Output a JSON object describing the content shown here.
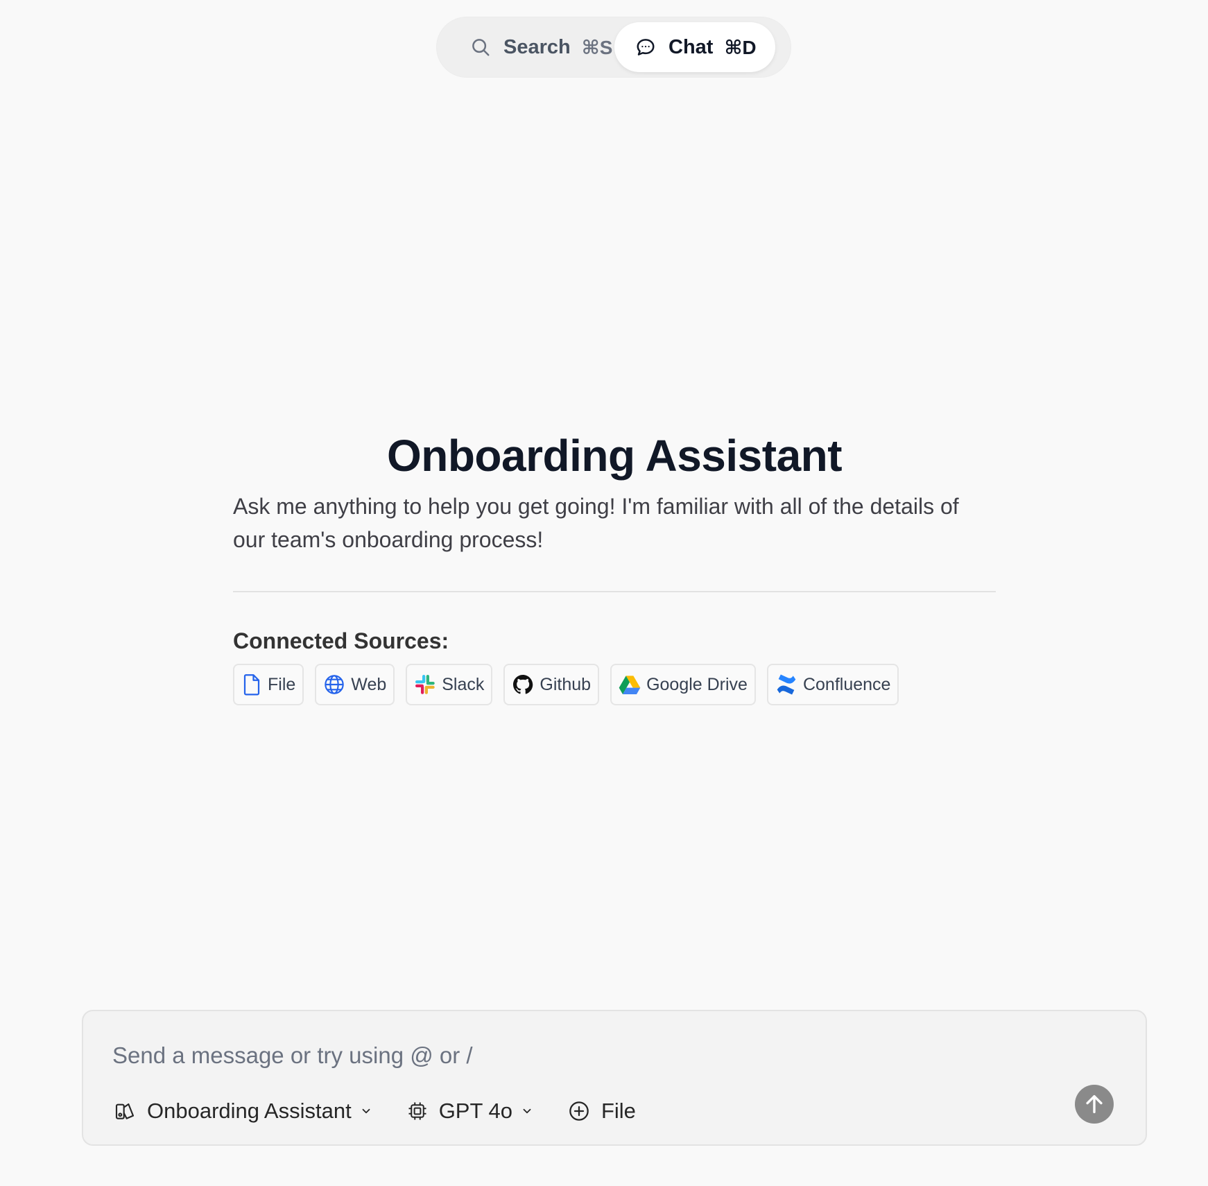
{
  "top_toggle": {
    "search": {
      "label": "Search",
      "shortcut": "⌘S",
      "icon": "search-icon"
    },
    "chat": {
      "label": "Chat",
      "shortcut": "⌘D",
      "icon": "chat-bubble-icon",
      "selected": true
    }
  },
  "hero": {
    "title": "Onboarding Assistant",
    "description": "Ask me anything to help you get going! I'm familiar with all of the details of our team's onboarding process!"
  },
  "sources": {
    "heading": "Connected Sources:",
    "items": [
      {
        "label": "File",
        "icon": "file-icon"
      },
      {
        "label": "Web",
        "icon": "globe-icon"
      },
      {
        "label": "Slack",
        "icon": "slack-icon"
      },
      {
        "label": "Github",
        "icon": "github-icon"
      },
      {
        "label": "Google Drive",
        "icon": "google-drive-icon"
      },
      {
        "label": "Confluence",
        "icon": "confluence-icon"
      }
    ]
  },
  "composer": {
    "placeholder": "Send a message or try using @ or /",
    "value": "",
    "assistant_selector": {
      "label": "Onboarding Assistant",
      "icon": "assistant-icon"
    },
    "model_selector": {
      "label": "GPT 4o",
      "icon": "cpu-icon"
    },
    "attach": {
      "label": "File",
      "icon": "plus-circle-icon"
    },
    "send_icon": "arrow-up-icon"
  },
  "colors": {
    "background": "#f9f9f9",
    "accent_blue": "#2563eb",
    "send_button": "#8a8a8a"
  }
}
